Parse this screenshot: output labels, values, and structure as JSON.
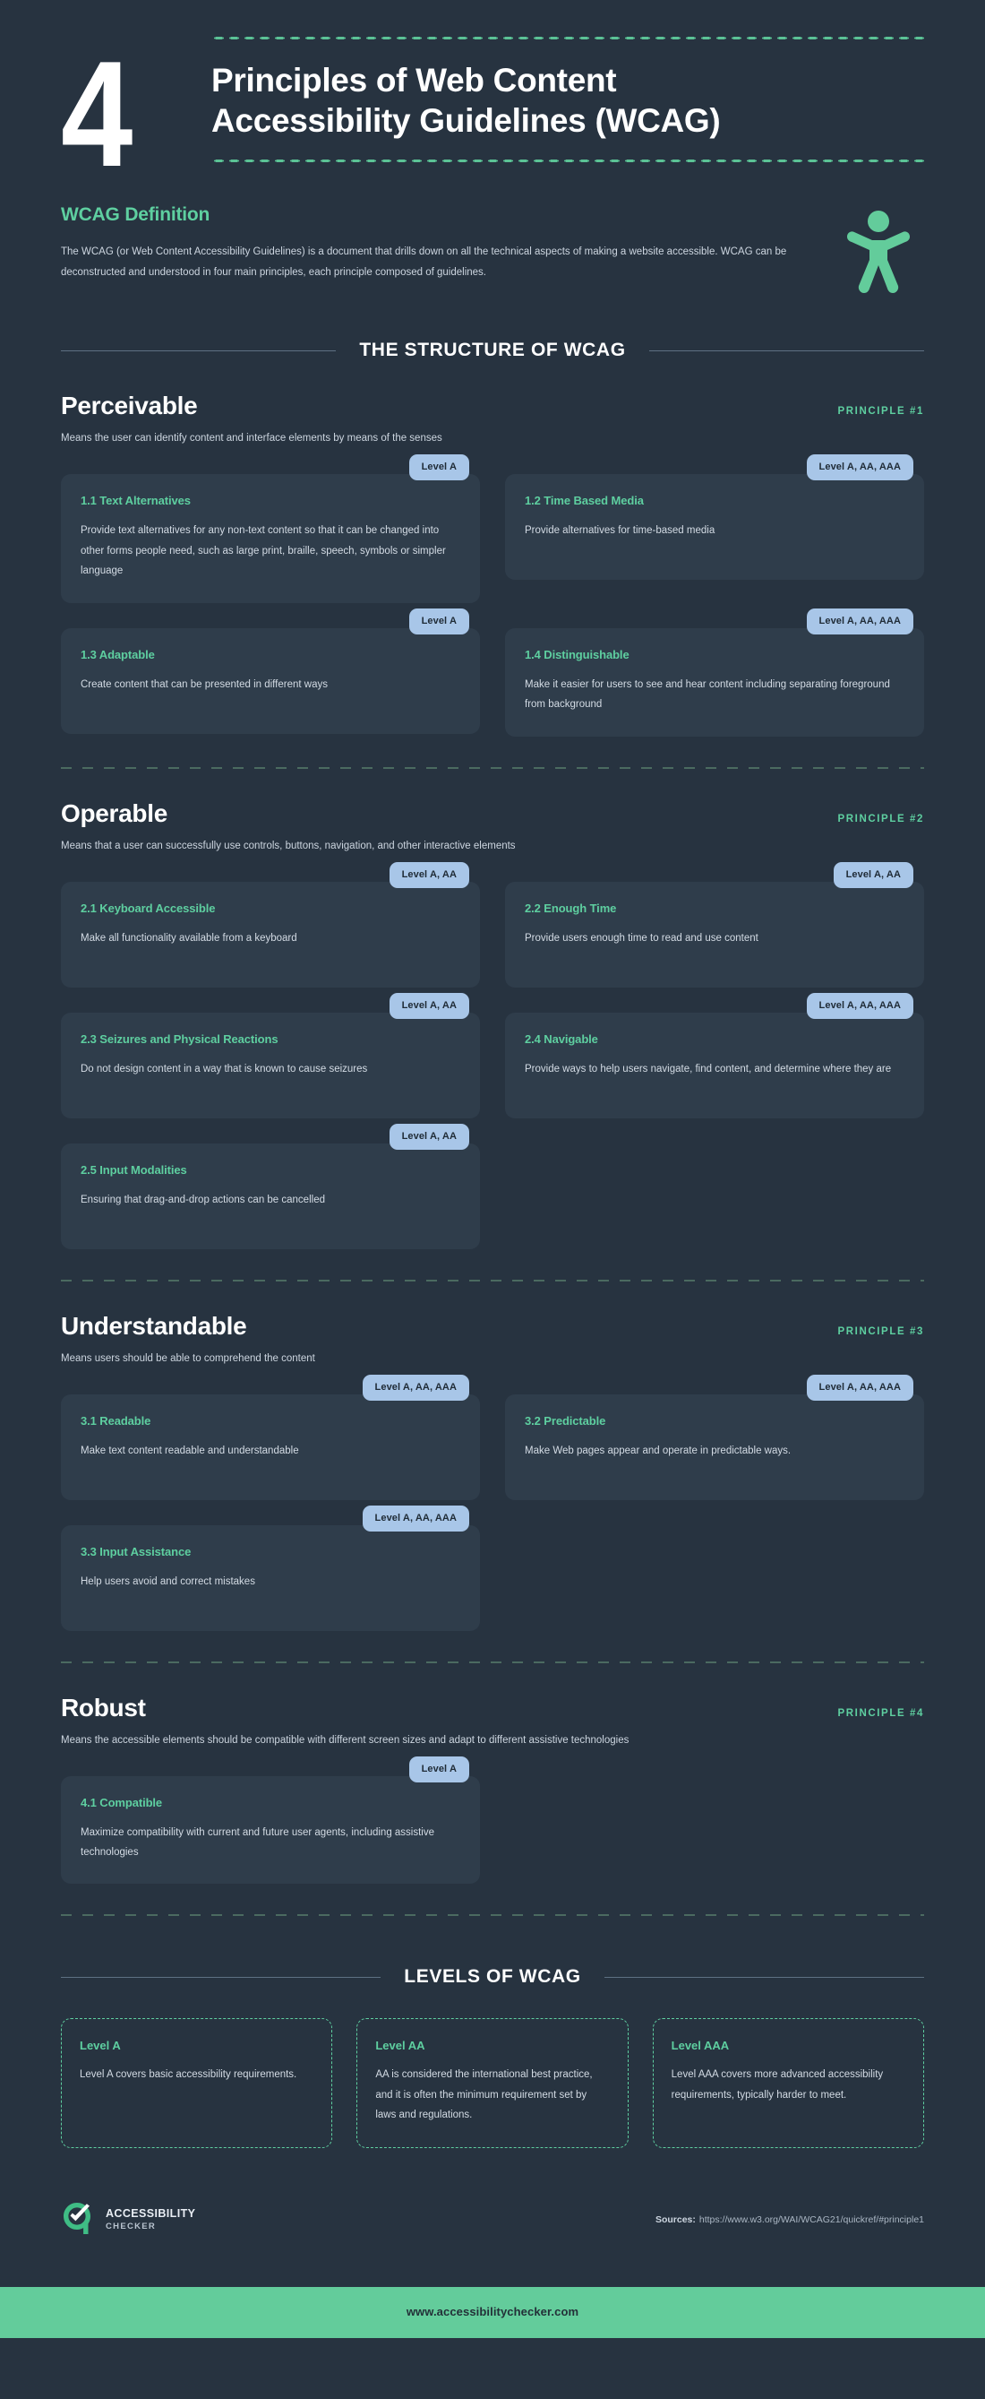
{
  "header": {
    "number": "4",
    "title_line1": "Principles of Web Content",
    "title_line2": "Accessibility Guidelines (WCAG)"
  },
  "definition": {
    "heading": "WCAG Definition",
    "body": "The WCAG (or Web Content Accessibility Guidelines) is a document that drills down on all the technical aspects of making a website accessible. WCAG can be deconstructed and understood in four main principles, each principle composed of guidelines.",
    "icon": "accessibility-person-icon"
  },
  "structure_heading": "THE STRUCTURE OF WCAG",
  "levels_heading": "LEVELS OF WCAG",
  "principles": [
    {
      "name": "Perceivable",
      "number_label": "PRINCIPLE #1",
      "subtitle": "Means the user can identify content and interface elements by means of the senses",
      "guidelines": [
        {
          "badge": "Level A",
          "title": "1.1  Text Alternatives",
          "body": "Provide text alternatives for any non-text content so that it can be changed into other forms people need, such as large print, braille, speech, symbols or simpler language"
        },
        {
          "badge": "Level A, AA, AAA",
          "title": "1.2  Time Based Media",
          "body": "Provide alternatives for time-based media"
        },
        {
          "badge": "Level A",
          "title": "1.3  Adaptable",
          "body": "Create content that can be presented in different ways"
        },
        {
          "badge": "Level A, AA, AAA",
          "title": "1.4  Distinguishable",
          "body": "Make it easier for users to see and hear content including separating foreground from background"
        }
      ]
    },
    {
      "name": "Operable",
      "number_label": "PRINCIPLE #2",
      "subtitle": "Means that a user can successfully use controls, buttons, navigation, and other interactive elements",
      "guidelines": [
        {
          "badge": "Level A, AA",
          "title": "2.1 Keyboard Accessible",
          "body": "Make all functionality available from a keyboard"
        },
        {
          "badge": "Level A, AA",
          "title": "2.2 Enough Time",
          "body": "Provide users enough time to read and use content"
        },
        {
          "badge": "Level A, AA",
          "title": "2.3  Seizures and Physical Reactions",
          "body": "Do not design content in a way that is known to cause seizures"
        },
        {
          "badge": "Level A, AA, AAA",
          "title": "2.4 Navigable",
          "body": "Provide ways to help users navigate, find content, and determine where they are"
        },
        {
          "badge": "Level A, AA",
          "title": "2.5  Input Modalities",
          "body": "Ensuring that drag-and-drop actions can be cancelled"
        }
      ]
    },
    {
      "name": "Understandable",
      "number_label": "PRINCIPLE #3",
      "subtitle": "Means users should be able to comprehend the content",
      "guidelines": [
        {
          "badge": "Level A, AA, AAA",
          "title": "3.1  Readable",
          "body": "Make text content readable and understandable"
        },
        {
          "badge": "Level A, AA, AAA",
          "title": "3.2  Predictable",
          "body": "Make Web pages appear and operate in predictable ways."
        },
        {
          "badge": "Level A, AA, AAA",
          "title": "3.3 Input Assistance",
          "body": "Help users avoid and correct mistakes"
        }
      ]
    },
    {
      "name": "Robust",
      "number_label": "PRINCIPLE #4",
      "subtitle": "Means the  accessible elements should be compatible with different screen sizes and adapt to different assistive technologies",
      "guidelines": [
        {
          "badge": "Level A",
          "title": "4.1 Compatible",
          "body": "Maximize compatibility with current and future user agents, including assistive technologies"
        }
      ]
    }
  ],
  "levels": [
    {
      "title": "Level A",
      "body": "Level A covers basic accessibility requirements."
    },
    {
      "title": "Level AA",
      "body": "AA is considered the international best practice, and it is often the minimum requirement set by laws and regulations."
    },
    {
      "title": "Level AAA",
      "body": "Level AAA covers more advanced accessibility requirements, typically harder to meet."
    }
  ],
  "footer": {
    "brand_line1": "ACCESSIBILITY",
    "brand_line2": "CHECKER",
    "logo_icon": "check-circle-logo-icon",
    "sources_label": "Sources:",
    "sources_url": "https://www.w3.org/WAI/WCAG21/quickref/#principle1",
    "bottom_url": "www.accessibilitychecker.com"
  },
  "colors": {
    "background": "#273340",
    "card": "#2f3d4b",
    "accent_green": "#5ecfa0",
    "badge_blue": "#a8c6e8",
    "footer_green": "#63cc9b"
  }
}
